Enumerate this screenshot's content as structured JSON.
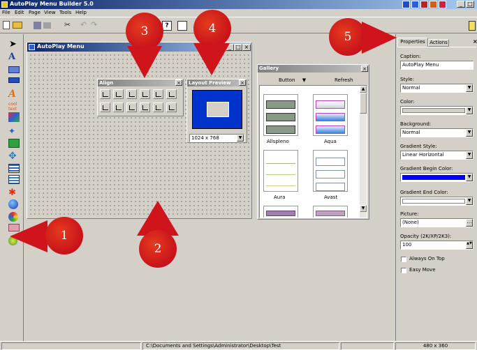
{
  "app": {
    "title": "AutoPlay Menu Builder 5.0"
  },
  "menubar": [
    "File",
    "Edit",
    "Page",
    "View",
    "Tools",
    "Help"
  ],
  "design_window": {
    "title": "AutoPlay Menu"
  },
  "align_panel": {
    "title": "Align"
  },
  "layout_preview": {
    "title": "Layout Preview",
    "resolution": "1024 x 768"
  },
  "gallery": {
    "title": "Gallery",
    "button_label": "Button",
    "refresh_label": "Refresh",
    "items": [
      "Allspleno",
      "Aqua",
      "Aura",
      "Avast"
    ]
  },
  "properties": {
    "tabs": [
      "Properties",
      "Actions"
    ],
    "caption_label": "Caption:",
    "caption_value": "AutoPlay Menu",
    "style_label": "Style:",
    "style_value": "Normal",
    "color_label": "Color:",
    "background_label": "Background:",
    "background_value": "Normal",
    "gradient_style_label": "Gradient Style:",
    "gradient_style_value": "Linear Horizontal",
    "gradient_begin_label": "Gradient Begin Color:",
    "gradient_begin_color": "#0000ff",
    "gradient_end_label": "Gradient End Color:",
    "picture_label": "Picture:",
    "picture_value": "(None)",
    "opacity_label": "Opacity (2K/XP/2K3):",
    "opacity_value": "100",
    "always_on_top_label": "Always On Top",
    "easy_move_label": "Easy Move"
  },
  "statusbar": {
    "path": "C:\\Documents and Settings\\Administrator\\Desktop\\Test",
    "size": "480 x 360"
  },
  "callouts": [
    "1",
    "2",
    "3",
    "4",
    "5"
  ],
  "colors": {
    "titlebar_start": "#0a246a",
    "titlebar_end": "#a6caf0",
    "callout": "#d0141c",
    "preview_bg": "#0033cc"
  }
}
